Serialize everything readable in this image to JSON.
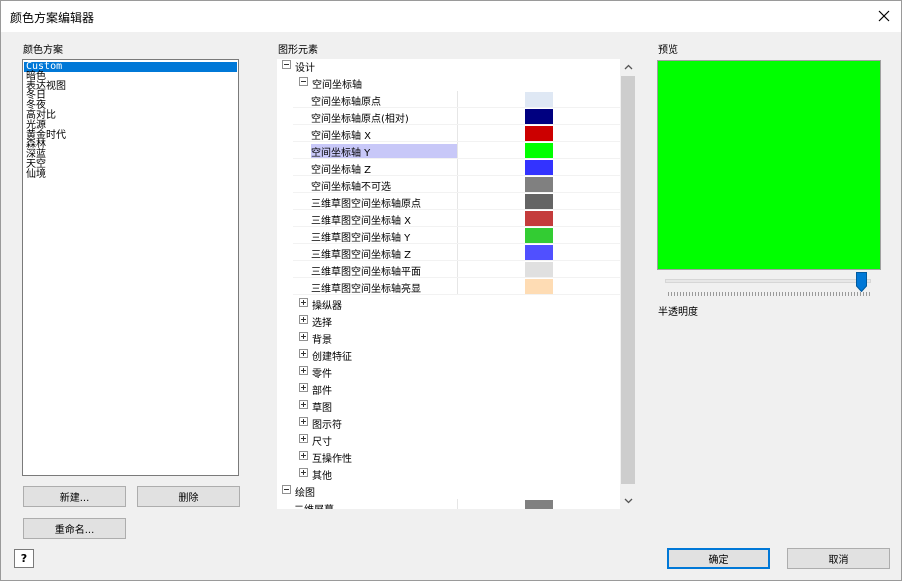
{
  "window": {
    "title": "颜色方案编辑器"
  },
  "schemes": {
    "label": "颜色方案",
    "items": [
      "Custom",
      "暗色",
      "表达视图",
      "冬日",
      "冬夜",
      "高对比",
      "光源",
      "黄金时代",
      "森林",
      "深蓝",
      "天空",
      "仙境"
    ],
    "selected_index": 0
  },
  "buttons": {
    "new": "新建...",
    "delete": "删除",
    "rename": "重命名...",
    "ok": "确定",
    "cancel": "取消",
    "help": "?"
  },
  "elements": {
    "label": "图形元素",
    "rows": [
      {
        "label": "设计",
        "level": 0,
        "type": "expander",
        "expanded": true
      },
      {
        "label": "空间坐标轴",
        "level": 1,
        "type": "expander",
        "expanded": true
      },
      {
        "label": "空间坐标轴原点",
        "level": 2,
        "type": "color",
        "color": "#dfe8f4"
      },
      {
        "label": "空间坐标轴原点(相对)",
        "level": 2,
        "type": "color",
        "color": "#000080"
      },
      {
        "label": "空间坐标轴 X",
        "level": 2,
        "type": "color",
        "color": "#cc0000"
      },
      {
        "label": "空间坐标轴 Y",
        "level": 2,
        "type": "color",
        "color": "#00ff00",
        "selected": true
      },
      {
        "label": "空间坐标轴 Z",
        "level": 2,
        "type": "color",
        "color": "#3333ff"
      },
      {
        "label": "空间坐标轴不可选",
        "level": 2,
        "type": "color",
        "color": "#808080"
      },
      {
        "label": "三维草图空间坐标轴原点",
        "level": 2,
        "type": "color",
        "color": "#646464"
      },
      {
        "label": "三维草图空间坐标轴 X",
        "level": 2,
        "type": "color",
        "color": "#c43c3c"
      },
      {
        "label": "三维草图空间坐标轴 Y",
        "level": 2,
        "type": "color",
        "color": "#33cc33"
      },
      {
        "label": "三维草图空间坐标轴 Z",
        "level": 2,
        "type": "color",
        "color": "#5050ff"
      },
      {
        "label": "三维草图空间坐标轴平面",
        "level": 2,
        "type": "color",
        "color": "#e0e0e0"
      },
      {
        "label": "三维草图空间坐标轴亮显",
        "level": 2,
        "type": "color",
        "color": "#fedcb4"
      },
      {
        "label": "操纵器",
        "level": 1,
        "type": "expander",
        "expanded": false
      },
      {
        "label": "选择",
        "level": 1,
        "type": "expander",
        "expanded": false
      },
      {
        "label": "背景",
        "level": 1,
        "type": "expander",
        "expanded": false
      },
      {
        "label": "创建特征",
        "level": 1,
        "type": "expander",
        "expanded": false
      },
      {
        "label": "零件",
        "level": 1,
        "type": "expander",
        "expanded": false
      },
      {
        "label": "部件",
        "level": 1,
        "type": "expander",
        "expanded": false
      },
      {
        "label": "草图",
        "level": 1,
        "type": "expander",
        "expanded": false
      },
      {
        "label": "图示符",
        "level": 1,
        "type": "expander",
        "expanded": false
      },
      {
        "label": "尺寸",
        "level": 1,
        "type": "expander",
        "expanded": false
      },
      {
        "label": "互操作性",
        "level": 1,
        "type": "expander",
        "expanded": false
      },
      {
        "label": "其他",
        "level": 1,
        "type": "expander",
        "expanded": false
      },
      {
        "label": "绘图",
        "level": 0,
        "type": "expander",
        "expanded": true
      },
      {
        "label": "二维屏幕",
        "level": 1,
        "type": "color",
        "color": "#808080"
      }
    ]
  },
  "preview": {
    "label": "预览",
    "color": "#00ff00",
    "transparency_label": "半透明度",
    "transparency_fraction": 0.98
  },
  "colors": {
    "accent": "#0078d7",
    "selection_highlight": "#c8c8f8"
  },
  "icons": {
    "close": "close-icon",
    "scroll_up": "chevron-up-icon",
    "scroll_down": "chevron-down-icon",
    "help": "help-icon"
  }
}
